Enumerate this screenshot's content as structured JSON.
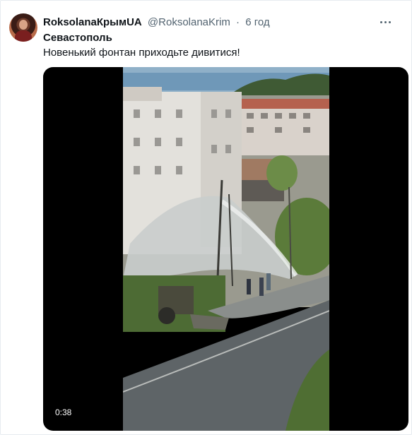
{
  "tweet": {
    "display_name": "RoksolanaКрымUA",
    "handle": "@RoksolanaKrim",
    "separator": "·",
    "time": "6 год",
    "line1": "Севастополь",
    "line2": "Новенький фонтан приходьте дивитися!",
    "more_icon": "more-dots-icon"
  },
  "video": {
    "duration": "0:38",
    "accent_colors": {
      "sky": "#7ea6c6",
      "road": "#5e6467",
      "greenery": "#4d6b34",
      "mist": "#c9cdcc"
    }
  }
}
